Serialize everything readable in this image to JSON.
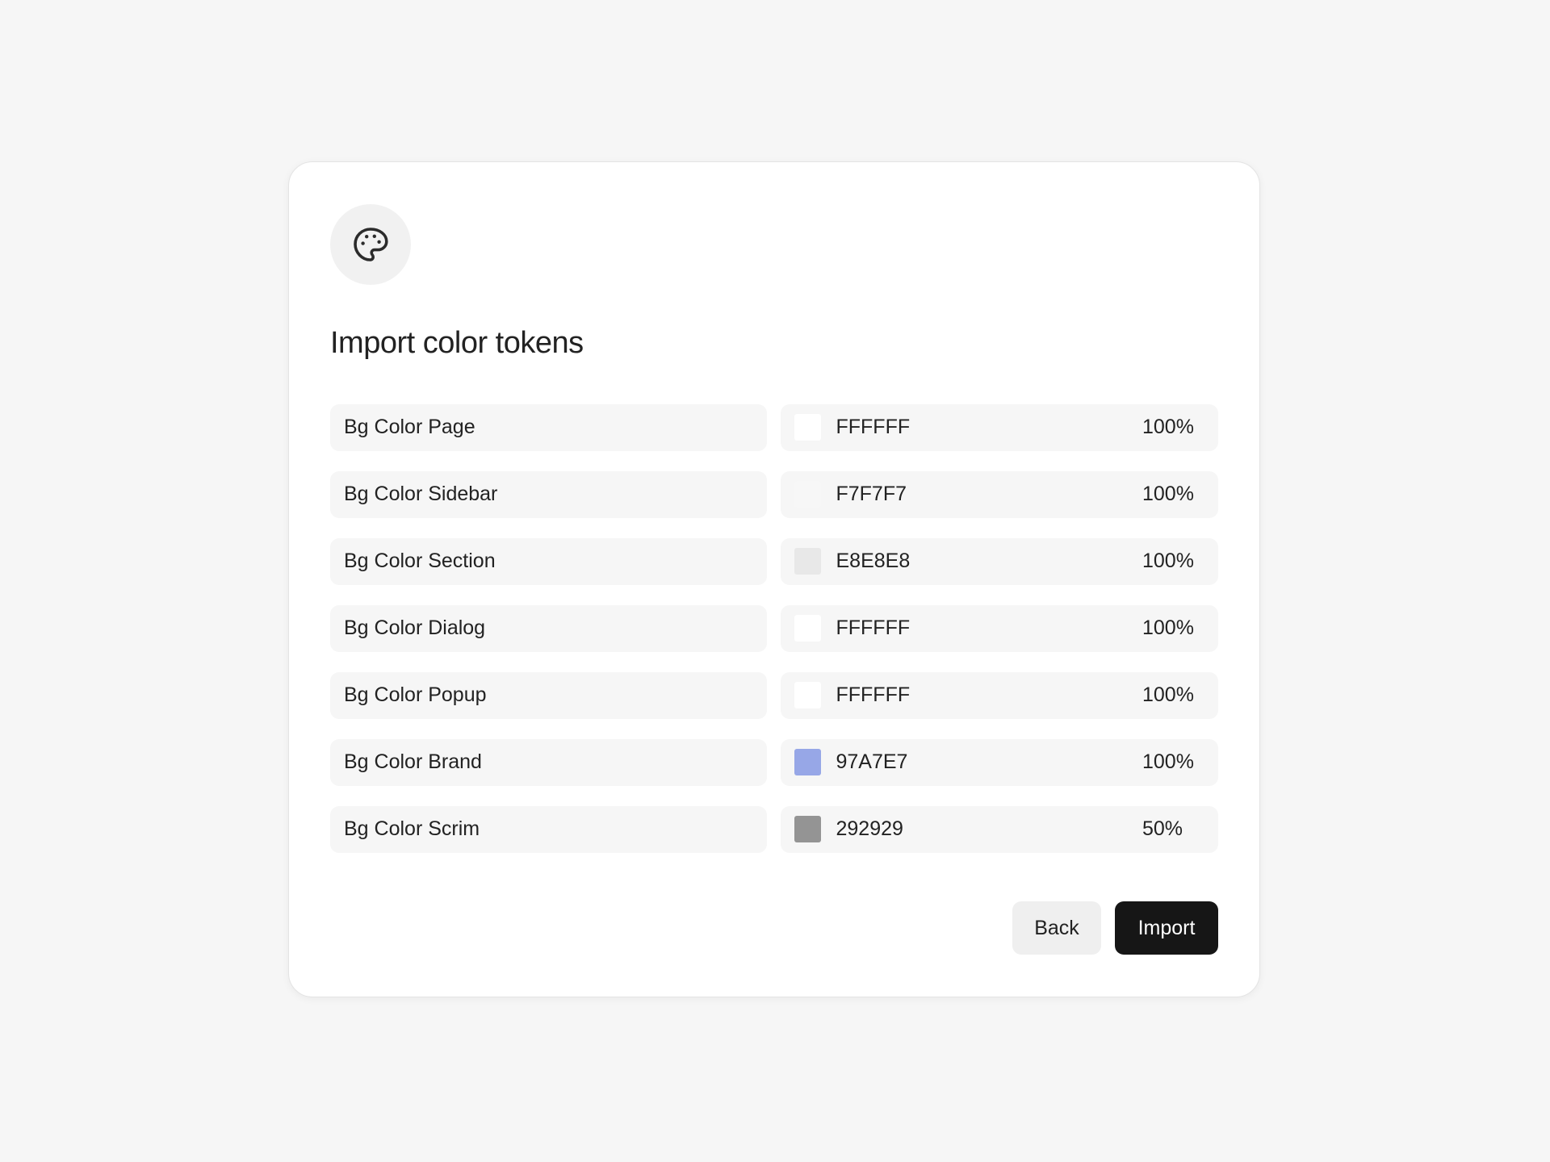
{
  "dialog": {
    "icon": "palette-icon",
    "title": "Import color tokens",
    "tokens": [
      {
        "name": "Bg Color Page",
        "hex": "FFFFFF",
        "opacity": "100%",
        "swatch_color": "#FFFFFF"
      },
      {
        "name": "Bg Color Sidebar",
        "hex": "F7F7F7",
        "opacity": "100%",
        "swatch_color": "#F7F7F7"
      },
      {
        "name": "Bg Color Section",
        "hex": "E8E8E8",
        "opacity": "100%",
        "swatch_color": "#E8E8E8"
      },
      {
        "name": "Bg Color Dialog",
        "hex": "FFFFFF",
        "opacity": "100%",
        "swatch_color": "#FFFFFF"
      },
      {
        "name": "Bg Color Popup",
        "hex": "FFFFFF",
        "opacity": "100%",
        "swatch_color": "#FFFFFF"
      },
      {
        "name": "Bg Color Brand",
        "hex": "97A7E7",
        "opacity": "100%",
        "swatch_color": "#97A7E7"
      },
      {
        "name": "Bg Color Scrim",
        "hex": "292929",
        "opacity": "50%",
        "swatch_color": "#949494"
      }
    ],
    "back_label": "Back",
    "import_label": "Import"
  },
  "colors": {
    "page_background": "#F6F6F6",
    "dialog_background": "#FFFFFF",
    "field_background": "#F6F6F6",
    "primary_button": "#161616",
    "secondary_button": "#EFEFEF"
  }
}
